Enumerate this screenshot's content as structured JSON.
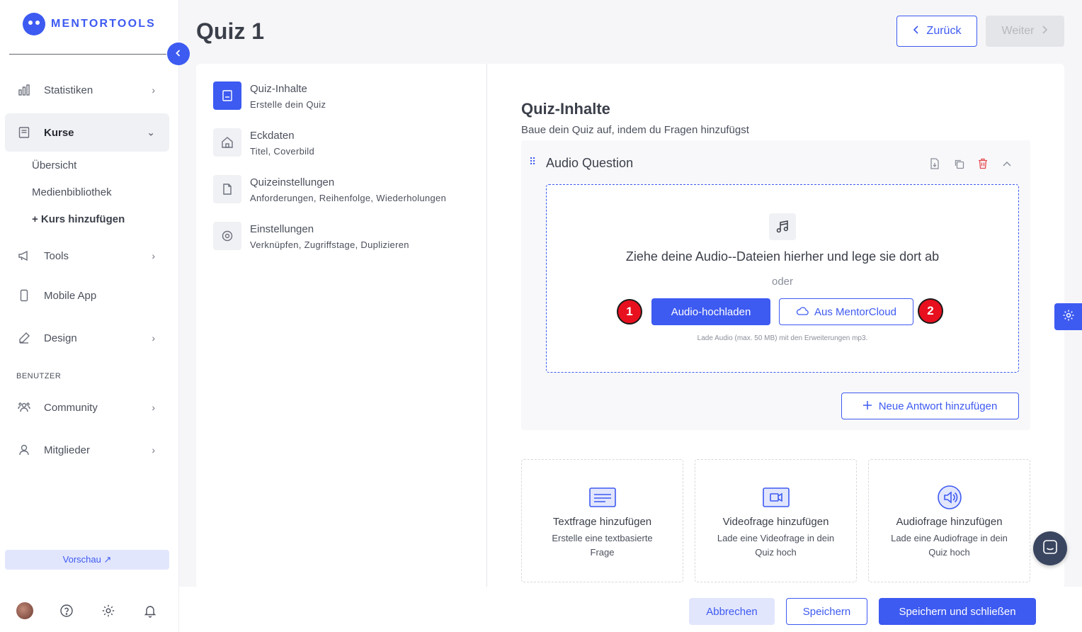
{
  "brand": {
    "name": "MENTORTOOLS",
    "accent": "#3d5af1"
  },
  "sidebar": {
    "items": [
      {
        "label": "Statistiken",
        "icon": "bar-chart-icon"
      },
      {
        "label": "Kurse",
        "icon": "book-icon",
        "active": true
      },
      {
        "label": "Tools",
        "icon": "megaphone-icon"
      },
      {
        "label": "Mobile App",
        "icon": "mobile-icon"
      },
      {
        "label": "Design",
        "icon": "pencil-icon"
      },
      {
        "label": "Community",
        "icon": "community-icon"
      },
      {
        "label": "Mitglieder",
        "icon": "user-icon"
      }
    ],
    "subitems": [
      "Übersicht",
      "Medienbibliothek",
      "+ Kurs hinzufügen"
    ],
    "section_label": "BENUTZER",
    "preview_label": "Vorschau ↗"
  },
  "header": {
    "title": "Quiz 1",
    "back_label": "Zurück",
    "next_label": "Weiter"
  },
  "steps": [
    {
      "title": "Quiz-Inhalte",
      "desc": "Erstelle dein Quiz",
      "icon": "book-icon",
      "active": true
    },
    {
      "title": "Eckdaten",
      "desc": "Titel, Coverbild",
      "icon": "home-icon"
    },
    {
      "title": "Quizeinstellungen",
      "desc": "Anforderungen, Reihenfolge, Wiederholungen",
      "icon": "file-icon"
    },
    {
      "title": "Einstellungen",
      "desc": "Verknüpfen, Zugriffstage, Duplizieren",
      "icon": "gear-icon"
    }
  ],
  "content": {
    "title": "Quiz-Inhalte",
    "subtitle": "Baue dein Quiz auf, indem du Fragen hinzufügst",
    "question": {
      "title": "Audio Question",
      "dropzone_text": "Ziehe deine Audio--Dateien hierher und lege sie dort ab",
      "or_text": "oder",
      "upload_label": "Audio-hochladen",
      "cloud_label": "Aus MentorCloud",
      "hint": "Lade Audio (max. 50 MB) mit den Erweiterungen mp3.",
      "badge1": "1",
      "badge2": "2",
      "add_answer_label": "Neue Antwort hinzufügen"
    },
    "add_cards": [
      {
        "title": "Textfrage hinzufügen",
        "desc": "Erstelle eine textbasierte Frage",
        "icon": "text-lines-icon"
      },
      {
        "title": "Videofrage hinzufügen",
        "desc": "Lade eine Videofrage in dein Quiz hoch",
        "icon": "video-icon"
      },
      {
        "title": "Audiofrage hinzufügen",
        "desc": "Lade eine Audiofrage in dein Quiz hoch",
        "icon": "speaker-icon"
      }
    ]
  },
  "footer": {
    "cancel_label": "Abbrechen",
    "save_label": "Speichern",
    "save_close_label": "Speichern und schließen"
  }
}
